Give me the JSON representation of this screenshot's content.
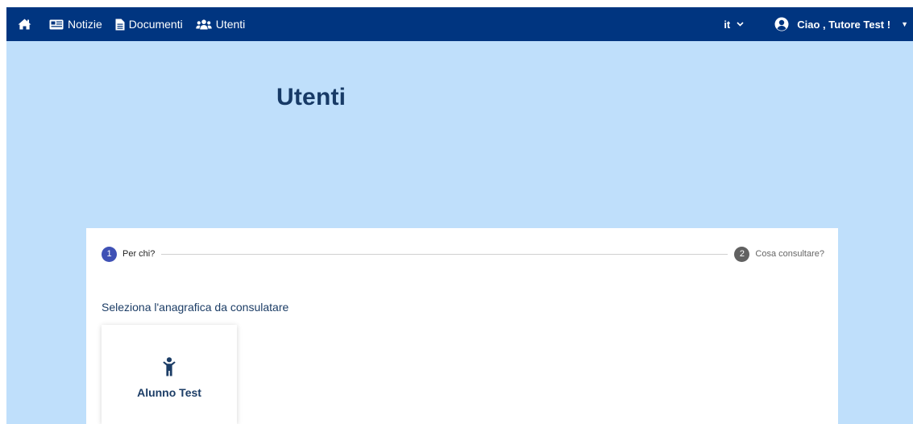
{
  "navbar": {
    "items": [
      {
        "label": "Notizie",
        "icon": "newspaper-icon"
      },
      {
        "label": "Documenti",
        "icon": "file-icon"
      },
      {
        "label": "Utenti",
        "icon": "users-icon"
      }
    ],
    "home_icon": "home-icon",
    "language": "it",
    "greeting": "Ciao , Tutore Test !"
  },
  "page": {
    "title": "Utenti"
  },
  "stepper": {
    "steps": [
      {
        "number": "1",
        "label": "Per chi?"
      },
      {
        "number": "2",
        "label": "Cosa consultare?"
      }
    ]
  },
  "selection": {
    "label": "Seleziona l'anagrafica da consulatare",
    "cards": [
      {
        "name": "Alunno Test",
        "icon": "child-icon"
      }
    ]
  },
  "colors": {
    "navbar_bg": "#003580",
    "hero_bg": "#bfdffb",
    "title": "#173a66",
    "active_step": "#3f51b5",
    "inactive_step": "#616161"
  }
}
